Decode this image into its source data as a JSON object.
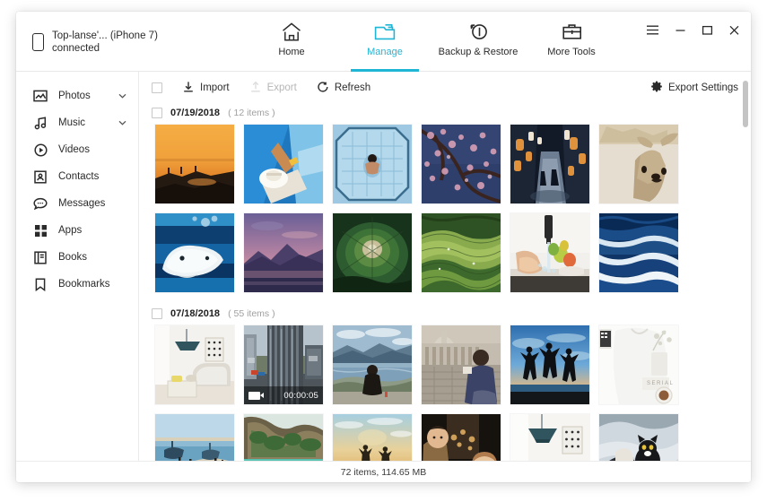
{
  "window": {
    "device_name": "Top-lanse'... (iPhone 7)",
    "device_status": "connected",
    "controls": {
      "menu": "☰",
      "minimize": "–",
      "maximize": "□",
      "close": "✕"
    }
  },
  "tabs": [
    {
      "label": "Home",
      "icon": "home-icon",
      "active": false
    },
    {
      "label": "Manage",
      "icon": "folder-icon",
      "active": true
    },
    {
      "label": "Backup & Restore",
      "icon": "backup-restore-icon",
      "active": false
    },
    {
      "label": "More Tools",
      "icon": "toolbox-icon",
      "active": false
    }
  ],
  "sidebar": {
    "items": [
      {
        "label": "Photos",
        "icon": "photo-icon",
        "caret": true
      },
      {
        "label": "Music",
        "icon": "music-icon",
        "caret": true
      },
      {
        "label": "Videos",
        "icon": "video-icon",
        "caret": false
      },
      {
        "label": "Contacts",
        "icon": "contact-icon",
        "caret": false
      },
      {
        "label": "Messages",
        "icon": "message-icon",
        "caret": false
      },
      {
        "label": "Apps",
        "icon": "apps-icon",
        "caret": false
      },
      {
        "label": "Books",
        "icon": "book-icon",
        "caret": false
      },
      {
        "label": "Bookmarks",
        "icon": "bookmark-icon",
        "caret": false
      }
    ]
  },
  "toolbar": {
    "import_label": "Import",
    "export_label": "Export",
    "refresh_label": "Refresh",
    "export_settings_label": "Export Settings",
    "export_disabled": true
  },
  "groups": [
    {
      "date": "07/19/2018",
      "count": "( 12 items )",
      "rows": [
        [
          {
            "name": "sunset-beach-silhouette",
            "c1": "#f0a43c",
            "c2": "#e87c2a",
            "c3": "#2a1c14",
            "style": "sunset"
          },
          {
            "name": "pool-sunbather-hat",
            "c1": "#2586c8",
            "c2": "#1f6fb0",
            "c3": "#f2e3d0",
            "style": "pool"
          },
          {
            "name": "aerial-swimming-pool",
            "c1": "#a7cde4",
            "c2": "#7fb6d8",
            "c3": "#5d9cc4",
            "style": "aerialpool"
          },
          {
            "name": "cherry-blossom-night",
            "c1": "#2d3c66",
            "c2": "#4a4f7a",
            "c3": "#c88fa5",
            "style": "blossom"
          },
          {
            "name": "lantern-alley-night",
            "c1": "#1a2436",
            "c2": "#2f3b52",
            "c3": "#d8893f",
            "style": "alley"
          },
          {
            "name": "deer-in-snow",
            "c1": "#efeae1",
            "c2": "#ded5c6",
            "c3": "#a38d6a",
            "style": "deer"
          }
        ],
        [
          {
            "name": "beluga-whale-underwater",
            "c1": "#0d3f6e",
            "c2": "#1767a5",
            "c3": "#e7eef2",
            "style": "beluga"
          },
          {
            "name": "mountain-lake-dusk",
            "c1": "#7b6aa0",
            "c2": "#c98aa0",
            "c3": "#3b3356",
            "style": "dusk"
          },
          {
            "name": "lotus-leaf-macro",
            "c1": "#17301c",
            "c2": "#2e5a30",
            "c3": "#cfc6a8",
            "style": "lotus"
          },
          {
            "name": "rice-terrace-aerial",
            "c1": "#4f7d38",
            "c2": "#86a94f",
            "c3": "#2c4a22",
            "style": "terrace"
          },
          {
            "name": "washing-fruit-sink",
            "c1": "#f4f2ee",
            "c2": "#d7d3cc",
            "c3": "#8fb14a",
            "style": "sink"
          },
          {
            "name": "ocean-waves-dark",
            "c1": "#0c2d5e",
            "c2": "#153f7e",
            "c3": "#dde8f2",
            "style": "waves"
          }
        ]
      ]
    },
    {
      "date": "07/18/2018",
      "count": "( 55 items )",
      "rows": [
        [
          {
            "name": "living-room-interior",
            "c1": "#f3f1ed",
            "c2": "#dedad2",
            "c3": "#2f4a52",
            "style": "livingroom"
          },
          {
            "name": "city-building-video",
            "c1": "#3c4248",
            "c2": "#6d757d",
            "c3": "#9aa4ac",
            "style": "building",
            "video": true,
            "duration": "00:00:05"
          },
          {
            "name": "woman-sitting-lakeside",
            "c1": "#9fb6c6",
            "c2": "#6c8fa4",
            "c3": "#3e5b46",
            "style": "lakeside"
          },
          {
            "name": "tourist-in-square",
            "c1": "#b9b3a6",
            "c2": "#8e8578",
            "c3": "#3a3f5c",
            "style": "square"
          },
          {
            "name": "jumping-silhouettes-sunset",
            "c1": "#3c7fc4",
            "c2": "#8fc0e4",
            "c3": "#101214",
            "style": "jumping"
          },
          {
            "name": "white-tshirt-flatlay",
            "c1": "#fbfbfa",
            "c2": "#ececea",
            "c3": "#cfcac2",
            "style": "tshirt"
          }
        ],
        [
          {
            "name": "tropical-beach-boats",
            "c1": "#bfd6e8",
            "c2": "#e8e0cd",
            "c3": "#4a7fa8",
            "style": "beachboats"
          },
          {
            "name": "limestone-cliff-lagoon",
            "c1": "#4a7e5a",
            "c2": "#2fa38e",
            "c3": "#d9e4dd",
            "style": "lagoon"
          },
          {
            "name": "couple-beach-sunset",
            "c1": "#e8c98c",
            "c2": "#9fc6d8",
            "c3": "#2a2418",
            "style": "couplebeach"
          },
          {
            "name": "family-portrait-warm",
            "c1": "#16120e",
            "c2": "#b07c4e",
            "c3": "#e8c79a",
            "style": "family"
          },
          {
            "name": "pendant-lamp-wall",
            "c1": "#f6f5f2",
            "c2": "#e2ded6",
            "c3": "#2f4a52",
            "style": "lamp"
          },
          {
            "name": "cat-on-lap",
            "c1": "#cfd6dc",
            "c2": "#7e8a92",
            "c3": "#16181a",
            "style": "cat"
          }
        ]
      ]
    }
  ],
  "status": {
    "text": "72 items, 114.65 MB"
  },
  "colors": {
    "accent": "#1fb6d6",
    "text": "#2b2b2b",
    "muted": "#a0a0a0",
    "disabled": "#b6b6b6"
  }
}
